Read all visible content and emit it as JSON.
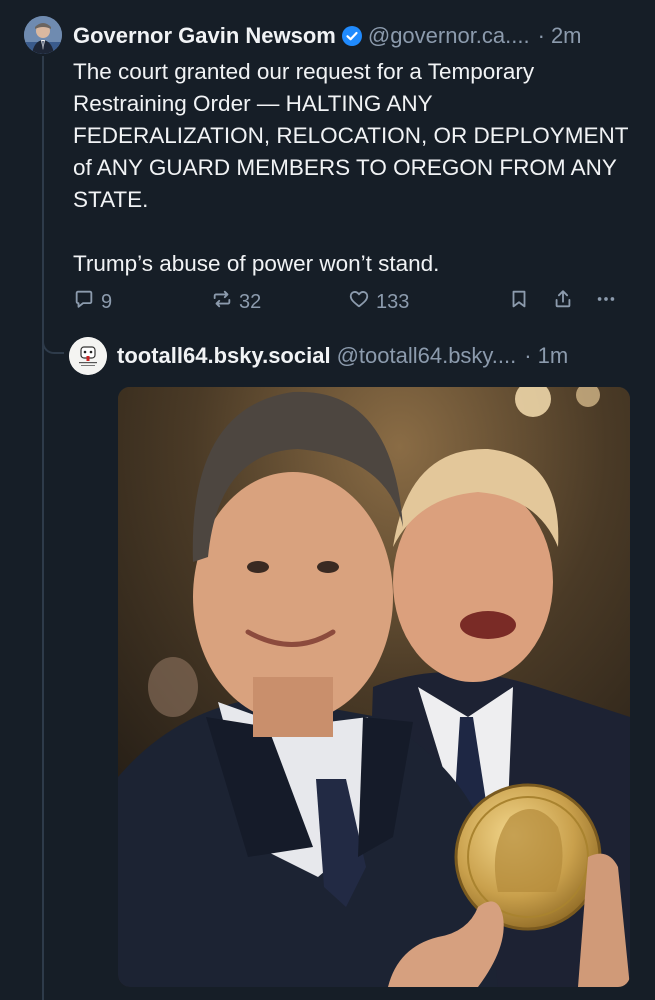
{
  "post": {
    "author_name": "Governor Gavin Newsom",
    "handle": "@governor.ca....",
    "separator": "·",
    "time": "2m",
    "text": "The court granted our request for a Temporary Restraining Order — HALTING ANY FEDERALIZATION, RELOCATION, OR DEPLOYMENT of ANY GUARD MEMBERS TO OREGON FROM ANY STATE.\n\nTrump’s abuse of power won’t stand.",
    "replies": "9",
    "reposts": "32",
    "likes": "133"
  },
  "quoted": {
    "author_name": "tootall64.bsky.social",
    "handle": "@tootall64.bsky....",
    "separator": "·",
    "time": "1m"
  },
  "icons": {
    "reply": "reply-icon",
    "repost": "repost-icon",
    "like": "heart-icon",
    "bookmark": "bookmark-icon",
    "share": "share-icon",
    "more": "more-icon",
    "verified": "verified-badge-icon"
  },
  "colors": {
    "background": "#161e27",
    "muted": "#8c9bad",
    "verified": "#208bfe",
    "text": "#f1f3f5"
  }
}
